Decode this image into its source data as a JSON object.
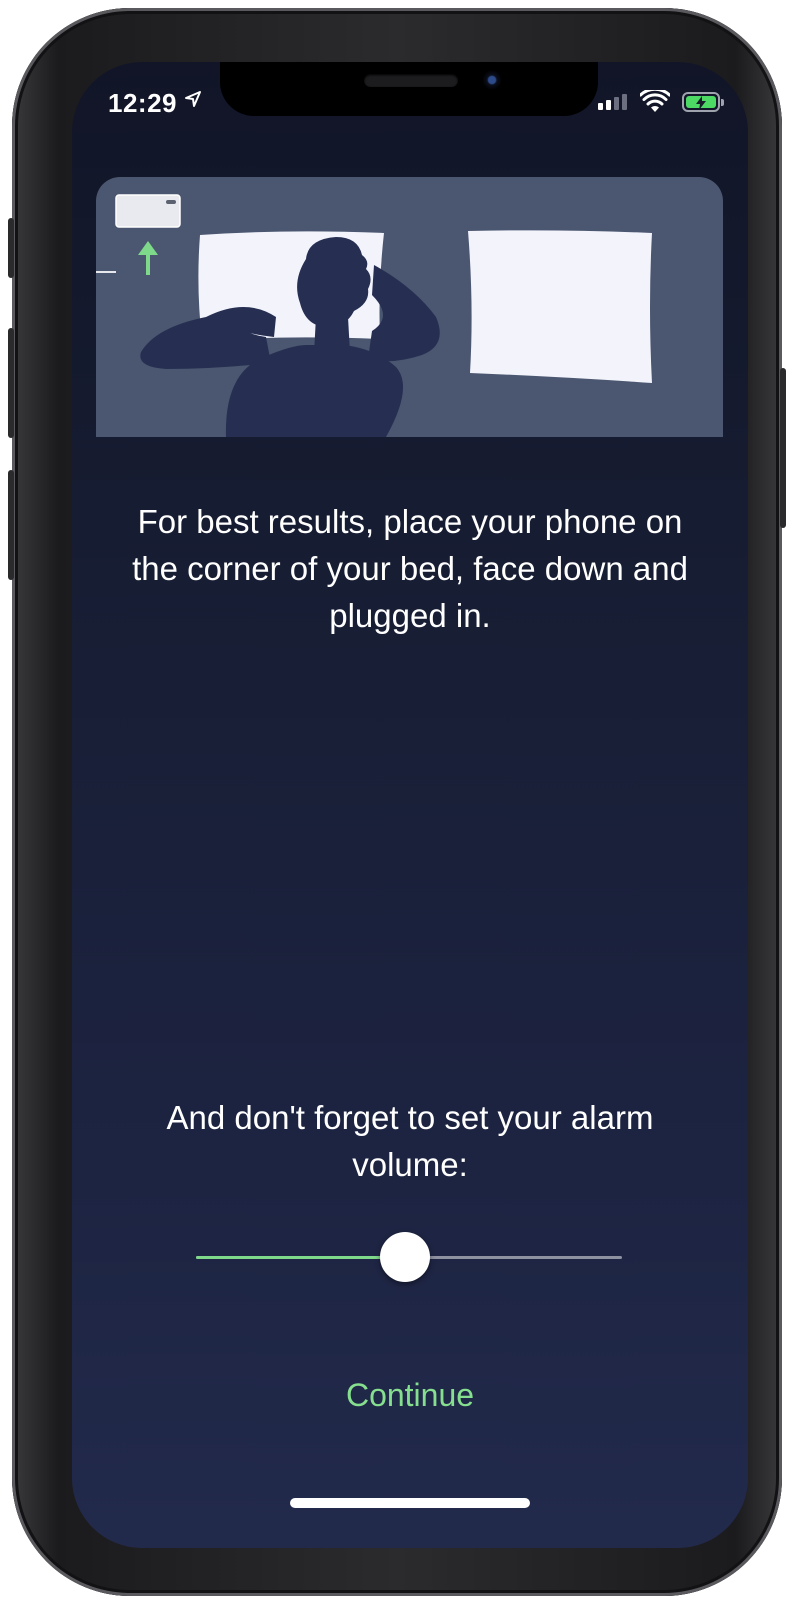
{
  "status_bar": {
    "time": "12:29",
    "icons": [
      "location-arrow-icon",
      "cellular-signal-icon",
      "wifi-icon",
      "battery-charging-icon"
    ]
  },
  "illustration": {
    "description_icons": [
      "phone-icon",
      "arrow-up-icon",
      "person-sleeping-icon",
      "pillow-icon"
    ],
    "colors": {
      "background": "#4b5770",
      "pillow": "#f2f3fb",
      "person": "#262f52",
      "arrow": "#7fd98a"
    }
  },
  "instruction": {
    "text": "For best results, place your phone on the corner of your bed, face down and plugged in."
  },
  "reminder": {
    "text": "And don't forget to set your alarm volume:"
  },
  "volume_slider": {
    "value": 0.49,
    "fill_color": "#7fd98a",
    "track_color": "#8e91a0"
  },
  "continue_button": {
    "label": "Continue",
    "color": "#86de8f"
  }
}
